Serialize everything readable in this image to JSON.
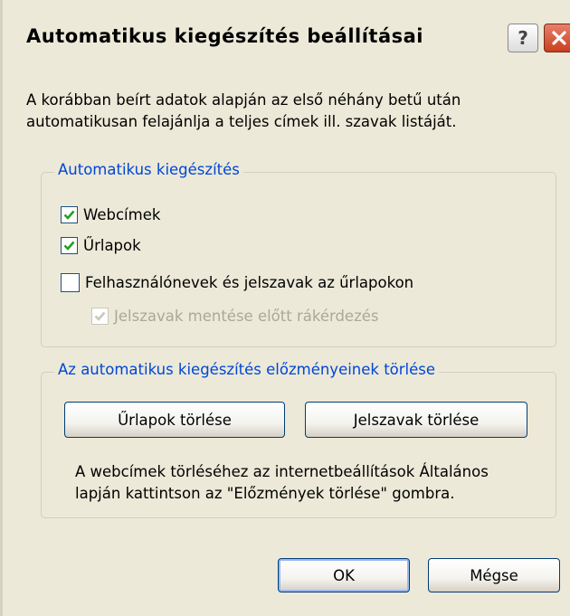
{
  "dialog": {
    "title": "Automatikus kiegészítés beállításai",
    "help_label": "?",
    "description": [
      "A korábban beírt adatok alapján az első néhány betű után",
      "automatikusan felajánlja a teljes címek ill. szavak listáját."
    ]
  },
  "autocomplete_group": {
    "label": "Automatikus kiegészítés",
    "options": [
      {
        "label": "Webcímek",
        "checked": true,
        "enabled": true
      },
      {
        "label": "Űrlapok",
        "checked": true,
        "enabled": true
      },
      {
        "label": "Felhasználónevek és jelszavak az űrlapokon",
        "checked": false,
        "enabled": true
      },
      {
        "label": "Jelszavak mentése előtt rákérdezés",
        "checked": true,
        "enabled": false
      }
    ]
  },
  "history_group": {
    "label": "Az automatikus kiegészítés előzményeinek törlése",
    "clear_forms_label": "Űrlapok törlése",
    "clear_passwords_label": "Jelszavak törlése",
    "note": [
      "A webcímek törléséhez az internetbeállítások Általános",
      "lapján kattintson az \"Előzmények törlése\" gombra."
    ]
  },
  "footer": {
    "ok_label": "OK",
    "cancel_label": "Mégse"
  },
  "colors": {
    "face": "#ece9d8",
    "group_label": "#0046d5",
    "check": "#21a121",
    "disabled_text": "#aca899"
  }
}
